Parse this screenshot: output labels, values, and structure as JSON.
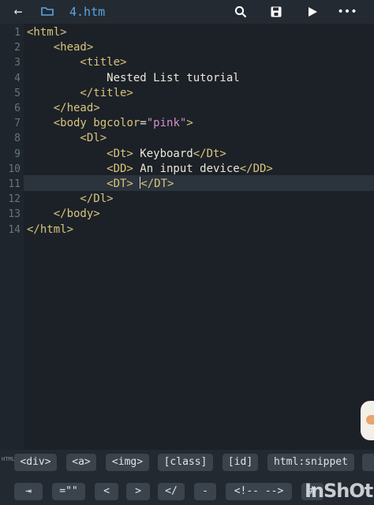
{
  "topbar": {
    "back_icon": "←",
    "folder_icon": "folder-icon",
    "file_name": "4.htm",
    "search_icon": "search-icon",
    "save_icon": "save-icon",
    "run_icon": "play-icon",
    "more_icon": "•••"
  },
  "editor": {
    "line_numbers": [
      "1",
      "2",
      "3",
      "4",
      "5",
      "6",
      "7",
      "8",
      "9",
      "10",
      "11",
      "12",
      "13",
      "14"
    ],
    "lines": [
      [
        {
          "t": "<html>",
          "c": "tag"
        }
      ],
      [
        {
          "t": "    <head>",
          "c": "tag"
        }
      ],
      [
        {
          "t": "        <title>",
          "c": "tag"
        }
      ],
      [
        {
          "t": "            Nested List tutorial",
          "c": "txt"
        }
      ],
      [
        {
          "t": "        </title>",
          "c": "tag"
        }
      ],
      [
        {
          "t": "    </head>",
          "c": "tag"
        }
      ],
      [
        {
          "t": "    <body ",
          "c": "tag"
        },
        {
          "t": "bgcolor",
          "c": "attr"
        },
        {
          "t": "=",
          "c": "txt"
        },
        {
          "t": "\"pink\"",
          "c": "str"
        },
        {
          "t": ">",
          "c": "tag"
        }
      ],
      [
        {
          "t": "        <Dl>",
          "c": "tag"
        }
      ],
      [
        {
          "t": "            <Dt>",
          "c": "tag"
        },
        {
          "t": " Keyboard",
          "c": "txt"
        },
        {
          "t": "</Dt>",
          "c": "tag"
        }
      ],
      [
        {
          "t": "            <DD>",
          "c": "tag"
        },
        {
          "t": " An input device",
          "c": "txt"
        },
        {
          "t": "</DD>",
          "c": "tag"
        }
      ],
      [
        {
          "t": "            <DT>",
          "c": "tag"
        },
        {
          "t": " ",
          "c": "txt"
        },
        {
          "t": "caret",
          "c": "caret"
        },
        {
          "t": "</DT>",
          "c": "tag"
        }
      ],
      [
        {
          "t": "        </Dl>",
          "c": "tag"
        }
      ],
      [
        {
          "t": "    </body>",
          "c": "tag"
        }
      ],
      [
        {
          "t": "</html>",
          "c": "tag"
        }
      ]
    ]
  },
  "bottom": {
    "side_label": "HTML",
    "row1": [
      "<div>",
      "<a>",
      "<img>",
      "[class]",
      "[id]",
      "html:snippet"
    ],
    "row2": [
      "⇥",
      "=\"\"",
      "<",
      ">",
      "</",
      "-",
      "<!-- -->",
      "#"
    ]
  },
  "watermark": "InShOt"
}
